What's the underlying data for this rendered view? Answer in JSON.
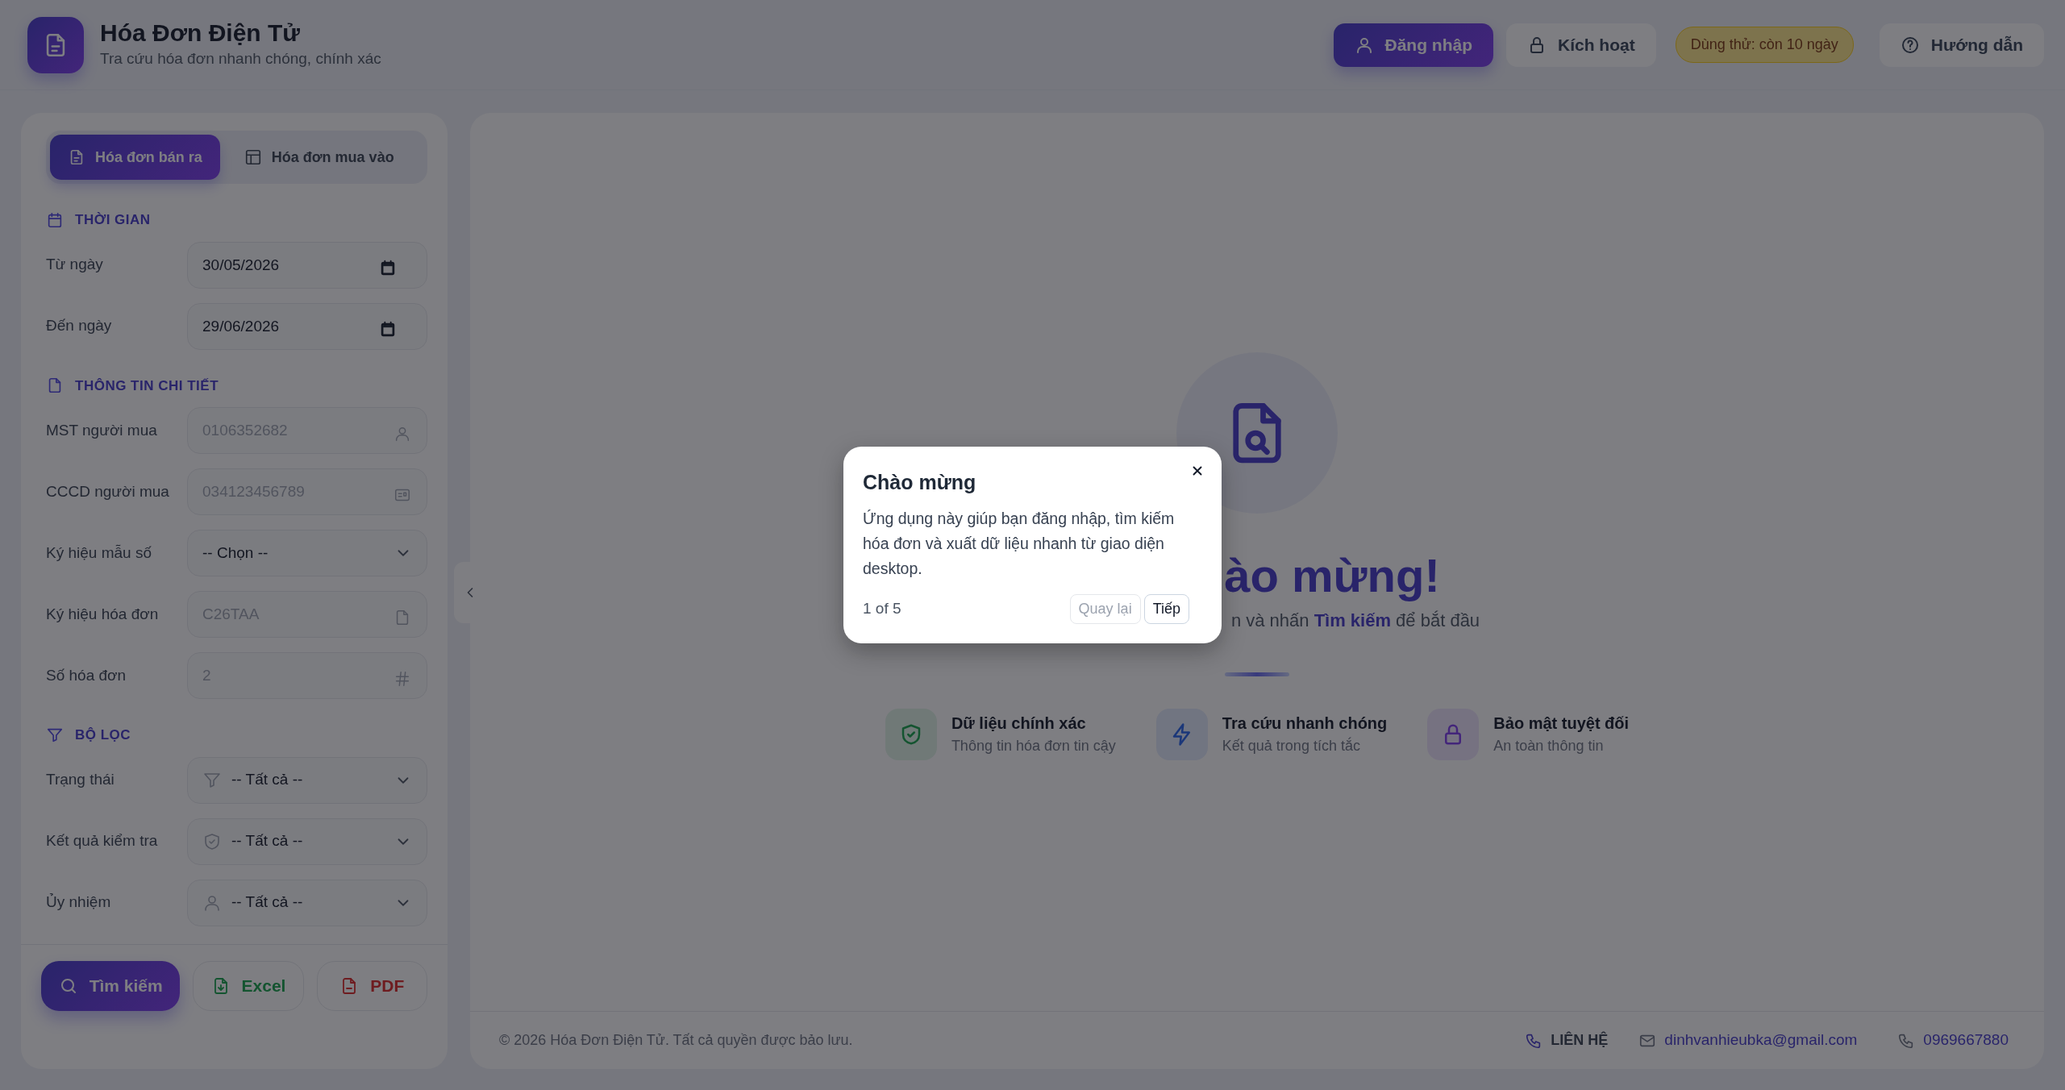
{
  "header": {
    "title": "Hóa Đơn Điện Tử",
    "subtitle": "Tra cứu hóa đơn nhanh chóng, chính xác",
    "actions": [
      {
        "kind": "primary",
        "label": "Đăng nhập"
      },
      {
        "kind": "light",
        "label": "Kích hoạt"
      },
      {
        "kind": "badge",
        "label": "Dùng thử: còn 10 ngày"
      },
      {
        "kind": "light",
        "label": "Hướng dẫn"
      }
    ]
  },
  "tabs": [
    {
      "label": "Hóa đơn bán ra",
      "selected": true
    },
    {
      "label": "Hóa đơn mua vào",
      "selected": false
    }
  ],
  "sections": [
    {
      "title": "THỜI GIAN",
      "fields": [
        {
          "kind": "date",
          "label": "Từ ngày",
          "value": "30/05/2026"
        },
        {
          "kind": "date",
          "label": "Đến ngày",
          "value": "29/06/2026"
        }
      ]
    },
    {
      "title": "THÔNG TIN CHI TIẾT",
      "fields": [
        {
          "kind": "text",
          "label": "MST người mua",
          "placeholder": "0106352682"
        },
        {
          "kind": "text",
          "label": "CCCD người mua",
          "placeholder": "034123456789"
        },
        {
          "kind": "select",
          "label": "Ký hiệu mẫu số",
          "value": "-- Chọn --"
        },
        {
          "kind": "text",
          "label": "Ký hiệu hóa đơn",
          "placeholder": "C26TAA"
        },
        {
          "kind": "text",
          "label": "Số hóa đơn",
          "placeholder": "2"
        }
      ]
    },
    {
      "title": "BỘ LỌC",
      "fields": [
        {
          "kind": "select",
          "label": "Trạng thái",
          "value": "-- Tất cả --"
        },
        {
          "kind": "select",
          "label": "Kết quả kiểm tra",
          "value": "-- Tất cả --"
        },
        {
          "kind": "select",
          "label": "Ủy nhiệm",
          "value": "-- Tất cả --"
        }
      ]
    }
  ],
  "actions": [
    {
      "kind": "primary",
      "label": "Tìm kiếm"
    },
    {
      "kind": "excel",
      "label": "Excel"
    },
    {
      "kind": "pdf",
      "label": "PDF"
    }
  ],
  "welcome": {
    "heading": "ào mừng!",
    "subtitle": "n và nhấn **Tìm kiếm** để bắt đầu",
    "features": [
      {
        "title": "Dữ liệu chính xác",
        "subtitle": "Thông tin hóa đơn tin cậy"
      },
      {
        "title": "Tra cứu nhanh chóng",
        "subtitle": "Kết quả trong tích tắc"
      },
      {
        "title": "Bảo mật tuyệt đối",
        "subtitle": "An toàn thông tin"
      }
    ]
  },
  "footer": {
    "copyright": "© 2026 Hóa Đơn Điện Tử. Tất cả quyền được bảo lưu.",
    "contact": "LIÊN HỆ",
    "email": "dinhvanhieubka@gmail.com",
    "phone": "0969667880"
  },
  "tour": {
    "title": "Chào mừng",
    "body": "Ứng dụng này giúp bạn đăng nhập, tìm kiếm hóa đơn và xuất dữ liệu nhanh từ giao diện desktop.",
    "progress": "1 of 5",
    "buttons": [
      {
        "label": "Quay lại",
        "disabled": true
      },
      {
        "label": "Tiếp",
        "disabled": false
      }
    ]
  }
}
